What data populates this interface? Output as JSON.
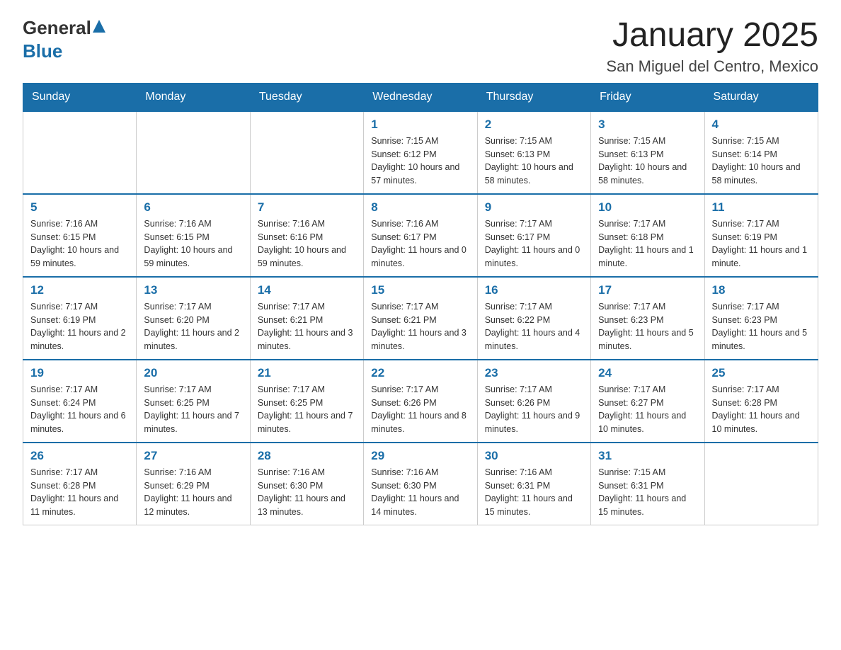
{
  "header": {
    "logo_general": "General",
    "logo_blue": "Blue",
    "main_title": "January 2025",
    "subtitle": "San Miguel del Centro, Mexico"
  },
  "calendar": {
    "days_of_week": [
      "Sunday",
      "Monday",
      "Tuesday",
      "Wednesday",
      "Thursday",
      "Friday",
      "Saturday"
    ],
    "weeks": [
      [
        {
          "day": "",
          "info": ""
        },
        {
          "day": "",
          "info": ""
        },
        {
          "day": "",
          "info": ""
        },
        {
          "day": "1",
          "info": "Sunrise: 7:15 AM\nSunset: 6:12 PM\nDaylight: 10 hours and 57 minutes."
        },
        {
          "day": "2",
          "info": "Sunrise: 7:15 AM\nSunset: 6:13 PM\nDaylight: 10 hours and 58 minutes."
        },
        {
          "day": "3",
          "info": "Sunrise: 7:15 AM\nSunset: 6:13 PM\nDaylight: 10 hours and 58 minutes."
        },
        {
          "day": "4",
          "info": "Sunrise: 7:15 AM\nSunset: 6:14 PM\nDaylight: 10 hours and 58 minutes."
        }
      ],
      [
        {
          "day": "5",
          "info": "Sunrise: 7:16 AM\nSunset: 6:15 PM\nDaylight: 10 hours and 59 minutes."
        },
        {
          "day": "6",
          "info": "Sunrise: 7:16 AM\nSunset: 6:15 PM\nDaylight: 10 hours and 59 minutes."
        },
        {
          "day": "7",
          "info": "Sunrise: 7:16 AM\nSunset: 6:16 PM\nDaylight: 10 hours and 59 minutes."
        },
        {
          "day": "8",
          "info": "Sunrise: 7:16 AM\nSunset: 6:17 PM\nDaylight: 11 hours and 0 minutes."
        },
        {
          "day": "9",
          "info": "Sunrise: 7:17 AM\nSunset: 6:17 PM\nDaylight: 11 hours and 0 minutes."
        },
        {
          "day": "10",
          "info": "Sunrise: 7:17 AM\nSunset: 6:18 PM\nDaylight: 11 hours and 1 minute."
        },
        {
          "day": "11",
          "info": "Sunrise: 7:17 AM\nSunset: 6:19 PM\nDaylight: 11 hours and 1 minute."
        }
      ],
      [
        {
          "day": "12",
          "info": "Sunrise: 7:17 AM\nSunset: 6:19 PM\nDaylight: 11 hours and 2 minutes."
        },
        {
          "day": "13",
          "info": "Sunrise: 7:17 AM\nSunset: 6:20 PM\nDaylight: 11 hours and 2 minutes."
        },
        {
          "day": "14",
          "info": "Sunrise: 7:17 AM\nSunset: 6:21 PM\nDaylight: 11 hours and 3 minutes."
        },
        {
          "day": "15",
          "info": "Sunrise: 7:17 AM\nSunset: 6:21 PM\nDaylight: 11 hours and 3 minutes."
        },
        {
          "day": "16",
          "info": "Sunrise: 7:17 AM\nSunset: 6:22 PM\nDaylight: 11 hours and 4 minutes."
        },
        {
          "day": "17",
          "info": "Sunrise: 7:17 AM\nSunset: 6:23 PM\nDaylight: 11 hours and 5 minutes."
        },
        {
          "day": "18",
          "info": "Sunrise: 7:17 AM\nSunset: 6:23 PM\nDaylight: 11 hours and 5 minutes."
        }
      ],
      [
        {
          "day": "19",
          "info": "Sunrise: 7:17 AM\nSunset: 6:24 PM\nDaylight: 11 hours and 6 minutes."
        },
        {
          "day": "20",
          "info": "Sunrise: 7:17 AM\nSunset: 6:25 PM\nDaylight: 11 hours and 7 minutes."
        },
        {
          "day": "21",
          "info": "Sunrise: 7:17 AM\nSunset: 6:25 PM\nDaylight: 11 hours and 7 minutes."
        },
        {
          "day": "22",
          "info": "Sunrise: 7:17 AM\nSunset: 6:26 PM\nDaylight: 11 hours and 8 minutes."
        },
        {
          "day": "23",
          "info": "Sunrise: 7:17 AM\nSunset: 6:26 PM\nDaylight: 11 hours and 9 minutes."
        },
        {
          "day": "24",
          "info": "Sunrise: 7:17 AM\nSunset: 6:27 PM\nDaylight: 11 hours and 10 minutes."
        },
        {
          "day": "25",
          "info": "Sunrise: 7:17 AM\nSunset: 6:28 PM\nDaylight: 11 hours and 10 minutes."
        }
      ],
      [
        {
          "day": "26",
          "info": "Sunrise: 7:17 AM\nSunset: 6:28 PM\nDaylight: 11 hours and 11 minutes."
        },
        {
          "day": "27",
          "info": "Sunrise: 7:16 AM\nSunset: 6:29 PM\nDaylight: 11 hours and 12 minutes."
        },
        {
          "day": "28",
          "info": "Sunrise: 7:16 AM\nSunset: 6:30 PM\nDaylight: 11 hours and 13 minutes."
        },
        {
          "day": "29",
          "info": "Sunrise: 7:16 AM\nSunset: 6:30 PM\nDaylight: 11 hours and 14 minutes."
        },
        {
          "day": "30",
          "info": "Sunrise: 7:16 AM\nSunset: 6:31 PM\nDaylight: 11 hours and 15 minutes."
        },
        {
          "day": "31",
          "info": "Sunrise: 7:15 AM\nSunset: 6:31 PM\nDaylight: 11 hours and 15 minutes."
        },
        {
          "day": "",
          "info": ""
        }
      ]
    ]
  }
}
